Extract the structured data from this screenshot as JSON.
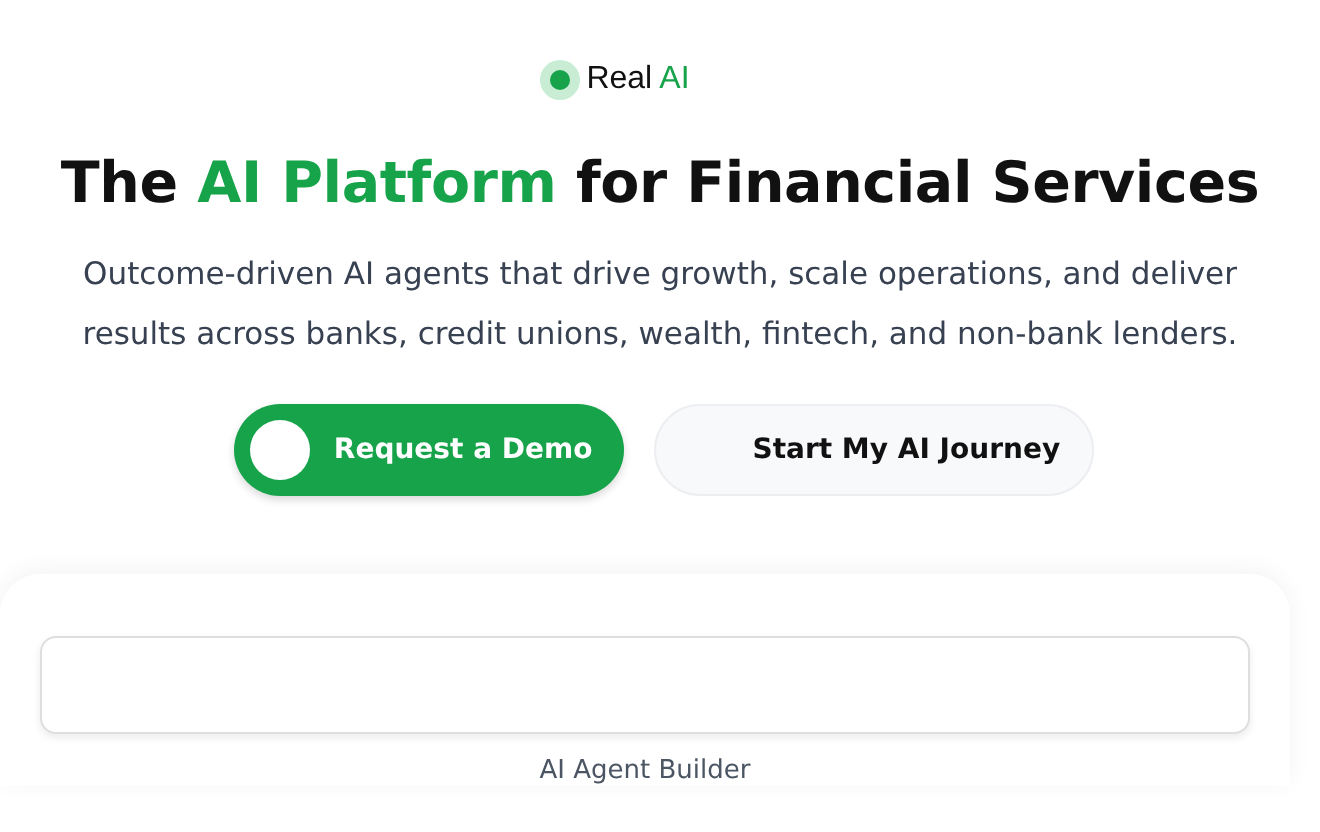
{
  "badge": {
    "parts": [
      {
        "text": "Real ",
        "accent": false
      },
      {
        "text": "AI",
        "accent": true
      }
    ]
  },
  "headline": {
    "parts": [
      {
        "text": "The ",
        "accent": false
      },
      {
        "text": "AI Platform",
        "accent": true
      },
      {
        "text": " for Financial Services",
        "accent": false
      }
    ]
  },
  "subtitle": "Outcome-driven AI agents that drive growth, scale operations, and deliver results across banks, credit unions, wealth, fintech, and non-bank lenders.",
  "buttons": [
    {
      "label": "Request a Demo",
      "kind": "primary"
    },
    {
      "label": "Start My AI Journey",
      "kind": "secondary"
    }
  ],
  "builder": {
    "caption": "AI Agent Builder"
  }
}
